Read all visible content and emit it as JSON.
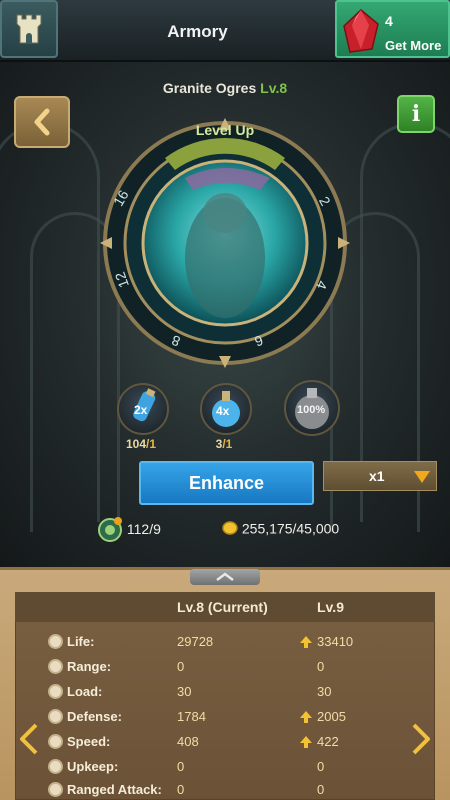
{
  "header": {
    "title": "Armory",
    "gem_count": "4",
    "get_more_label": "Get More",
    "icons": {
      "home": "castle-tower-icon",
      "currency": "red-gem-icon"
    }
  },
  "unit": {
    "name": "Granite Ogres",
    "level_label": "Lv.8",
    "level_up_label": "Level Up",
    "wheel_numbers": [
      "2",
      "4",
      "6",
      "8",
      "12",
      "16"
    ]
  },
  "potions": [
    {
      "label": "2x",
      "count": "104",
      "required": "/1"
    },
    {
      "label": "4x",
      "count": "3",
      "required": "/1"
    },
    {
      "label": "100%"
    }
  ],
  "actions": {
    "enhance_label": "Enhance",
    "multiplier_value": "x1"
  },
  "resources": {
    "stones": "112/9",
    "gold": "255,175/45,000"
  },
  "stats": {
    "current_header": "Lv.8 (Current)",
    "next_header": "Lv.9",
    "rows": [
      {
        "label": "Life:",
        "current": "29728",
        "next": "33410",
        "increase": true,
        "icon": "heart-icon"
      },
      {
        "label": "Range:",
        "current": "0",
        "next": "0",
        "increase": false,
        "icon": "range-icon"
      },
      {
        "label": "Load:",
        "current": "30",
        "next": "30",
        "increase": false,
        "icon": "load-icon"
      },
      {
        "label": "Defense:",
        "current": "1784",
        "next": "2005",
        "increase": true,
        "icon": "shield-icon"
      },
      {
        "label": "Speed:",
        "current": "408",
        "next": "422",
        "increase": true,
        "icon": "speed-icon"
      },
      {
        "label": "Upkeep:",
        "current": "0",
        "next": "0",
        "increase": false,
        "icon": "upkeep-icon"
      },
      {
        "label": "Ranged Attack:",
        "current": "0",
        "next": "0",
        "increase": false,
        "icon": "ranged-attack-icon"
      }
    ]
  },
  "colors": {
    "accent_green": "#7fc34b",
    "enhance_blue": "#1f8ad6",
    "gold": "#e8b646",
    "panel_tan": "#c9a97b"
  }
}
